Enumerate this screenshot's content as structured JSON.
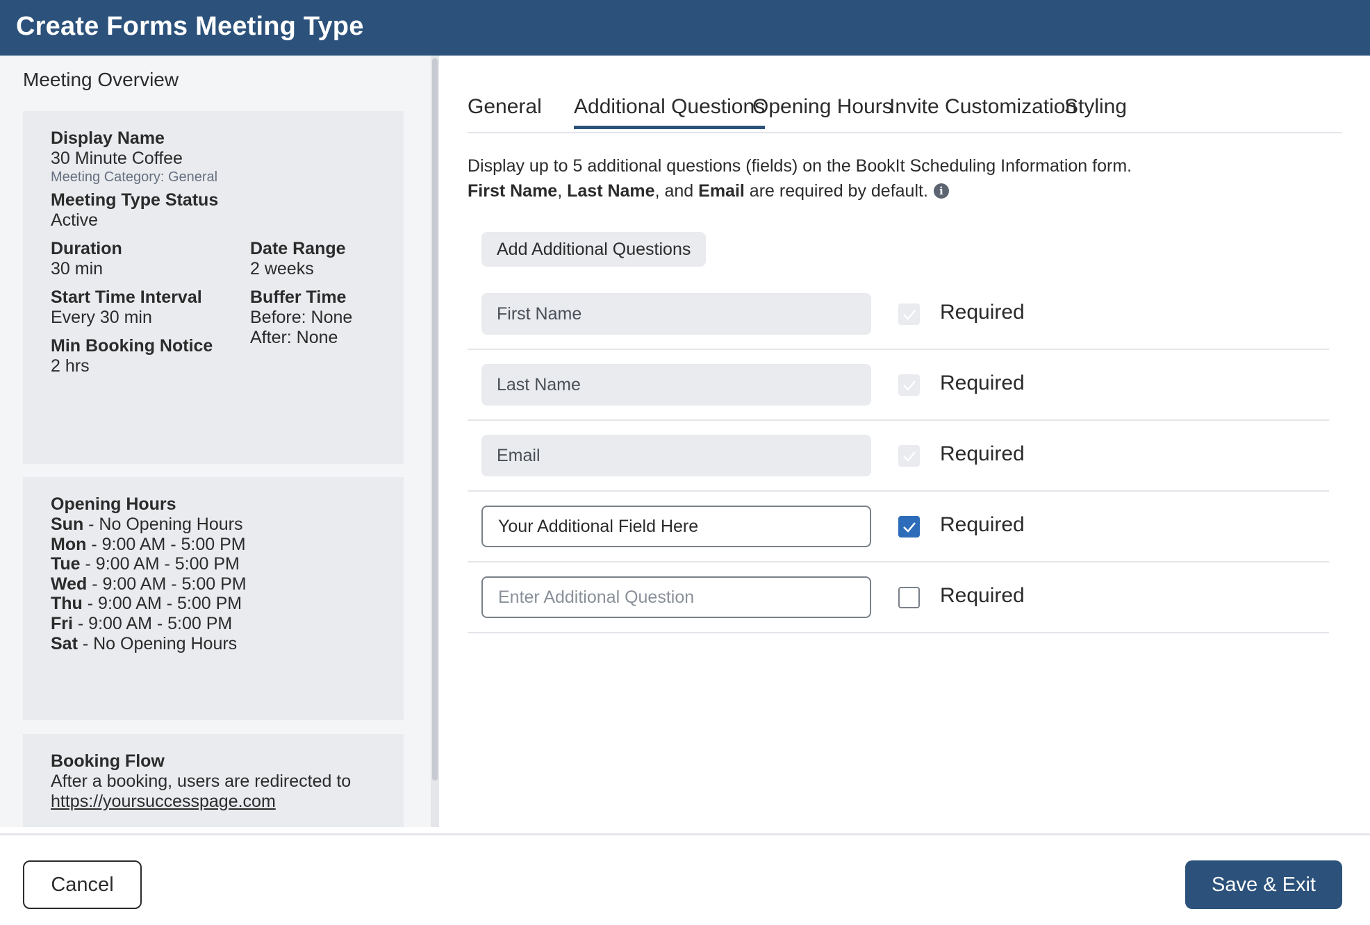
{
  "header": {
    "title": "Create Forms Meeting Type"
  },
  "sidebar": {
    "title": "Meeting Overview",
    "overview": {
      "display_name_label": "Display Name",
      "display_name_value": "30 Minute Coffee",
      "category": "Meeting Category: General",
      "status_label": "Meeting Type Status",
      "status_value": "Active",
      "duration_label": "Duration",
      "duration_value": "30 min",
      "date_range_label": "Date Range",
      "date_range_value": "2 weeks",
      "start_interval_label": "Start Time Interval",
      "start_interval_value": "Every 30 min",
      "buffer_label": "Buffer Time",
      "buffer_before": "Before: None",
      "buffer_after": "After: None",
      "min_notice_label": "Min Booking Notice",
      "min_notice_value": "2 hrs"
    },
    "opening_hours": {
      "title": "Opening Hours",
      "days": [
        {
          "day": "Sun",
          "hours": " - No Opening Hours"
        },
        {
          "day": "Mon",
          "hours": " - 9:00 AM - 5:00 PM"
        },
        {
          "day": "Tue",
          "hours": " - 9:00 AM - 5:00 PM"
        },
        {
          "day": "Wed",
          "hours": " - 9:00 AM - 5:00 PM"
        },
        {
          "day": "Thu",
          "hours": " - 9:00 AM - 5:00 PM"
        },
        {
          "day": "Fri",
          "hours": " - 9:00 AM - 5:00 PM"
        },
        {
          "day": "Sat",
          "hours": " - No Opening Hours"
        }
      ]
    },
    "booking_flow": {
      "title": "Booking Flow",
      "text": "After a booking, users are redirected to",
      "url": "https://yoursuccesspage.com"
    }
  },
  "tabs": [
    {
      "label": "General"
    },
    {
      "label": "Additional Questions",
      "active": true
    },
    {
      "label": "Opening Hours"
    },
    {
      "label": "Invite Customization"
    },
    {
      "label": "Styling"
    }
  ],
  "main": {
    "description_line1": "Display up to 5 additional questions (fields) on the BookIt Scheduling Information form.",
    "description_line2": {
      "first_name": "First Name",
      "sep1": ", ",
      "last_name": "Last Name",
      "sep2": ", and ",
      "email": "Email",
      "suffix": " are required by default."
    },
    "add_button": "Add Additional Questions",
    "required_label": "Required",
    "questions": [
      {
        "value": "First Name",
        "state": "disabled"
      },
      {
        "value": "Last Name",
        "state": "disabled"
      },
      {
        "value": "Email",
        "state": "disabled"
      },
      {
        "value": "Your Additional Field Here",
        "state": "checked"
      },
      {
        "value": "",
        "placeholder": "Enter Additional Question",
        "state": "unchecked"
      }
    ]
  },
  "footer": {
    "cancel": "Cancel",
    "save": "Save & Exit"
  },
  "colors": {
    "header": "#2c527b",
    "accent": "#2c6cb8",
    "panel": "#e9ebee"
  },
  "icons": {
    "info": "info-icon",
    "check": "check-icon"
  }
}
